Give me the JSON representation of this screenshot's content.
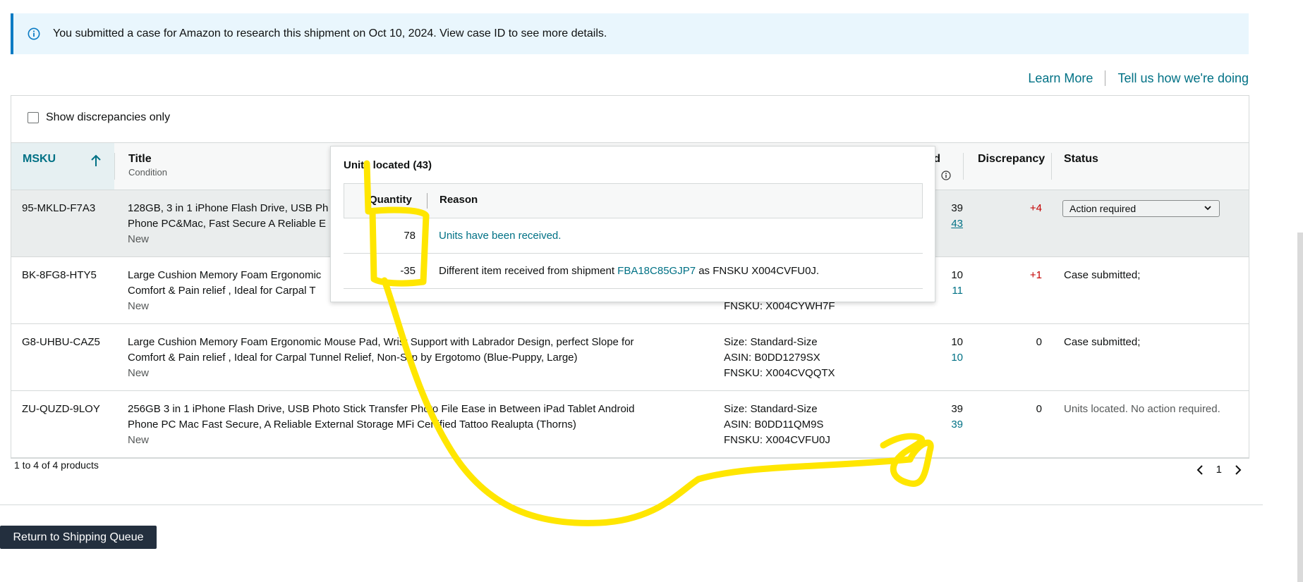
{
  "banner": {
    "message": "You submitted a case for Amazon to research this shipment on Oct 10, 2024. View case ID to see more details.",
    "icon": "info-icon",
    "color": "#e9f6fd"
  },
  "links": {
    "learn_more": "Learn More",
    "feedback": "Tell us how we're doing"
  },
  "filter": {
    "label": "Show discrepancies only",
    "checked": false
  },
  "table": {
    "headers": {
      "msku": "MSKU",
      "title": "Title",
      "title_sub": "Condition",
      "located": "ted",
      "discrepancy": "Discrepancy",
      "status": "Status"
    },
    "rows": [
      {
        "msku": "95-MKLD-F7A3",
        "title_line1": "128GB, 3 in 1 iPhone Flash Drive, USB Ph",
        "title_line2": "Phone PC&Mac, Fast Secure A Reliable E",
        "condition": "New",
        "details": [
          "",
          "",
          ""
        ],
        "expected": "39",
        "located": "43",
        "discrepancy": "+4",
        "status": "Action required"
      },
      {
        "msku": "BK-8FG8-HTY5",
        "title_line1": "Large Cushion Memory Foam Ergonomic",
        "title_line2": "Comfort & Pain relief , Ideal for Carpal T",
        "condition": "New",
        "details": [
          "",
          "",
          "FNSKU: X004CYWH7F"
        ],
        "expected": "10",
        "located": "11",
        "discrepancy": "+1",
        "status": "Case submitted;"
      },
      {
        "msku": "G8-UHBU-CAZ5",
        "title_line1": "Large Cushion Memory Foam Ergonomic Mouse Pad, Wrist Support with Labrador Design, perfect Slope for",
        "title_line2": "Comfort & Pain relief , Ideal for Carpal Tunnel Relief, Non-Slip by Ergotomo (Blue-Puppy, Large)",
        "condition": "New",
        "details": [
          "Size: Standard-Size",
          "ASIN: B0DD1279SX",
          "FNSKU: X004CVQQTX"
        ],
        "expected": "10",
        "located": "10",
        "discrepancy": "0",
        "status": "Case submitted;"
      },
      {
        "msku": "ZU-QUZD-9LOY",
        "title_line1": "256GB 3 in 1 iPhone Flash Drive, USB Photo Stick Transfer Photo File Ease in Between iPad Tablet Android",
        "title_line2": "Phone PC Mac Fast Secure, A Reliable External Storage MFi Certified Tattoo Realupta (Thorns)",
        "condition": "New",
        "details": [
          "Size: Standard-Size",
          "ASIN: B0DD11QM9S",
          "FNSKU: X004CVFU0J"
        ],
        "expected": "39",
        "located": "39",
        "discrepancy": "0",
        "status": "Units located. No action required."
      }
    ]
  },
  "footer": {
    "count": "1 to 4 of 4 products",
    "page": "1"
  },
  "return_button": "Return to Shipping Queue",
  "popover": {
    "title": "Units located (43)",
    "headers": {
      "quantity": "Quantity",
      "reason": "Reason"
    },
    "rows": [
      {
        "quantity": "78",
        "reason": "Units have been received.",
        "reason_link": true
      },
      {
        "quantity": "-35",
        "reason_prefix": "Different item received from shipment ",
        "shipment_link": "FBA18C85GJP7",
        "reason_suffix": " as FNSKU X004CVFU0J."
      }
    ]
  },
  "colors": {
    "link": "#007185",
    "discrepancy_positive": "#c40000",
    "button_dark": "#232f3e",
    "annotation": "#ffe600"
  }
}
